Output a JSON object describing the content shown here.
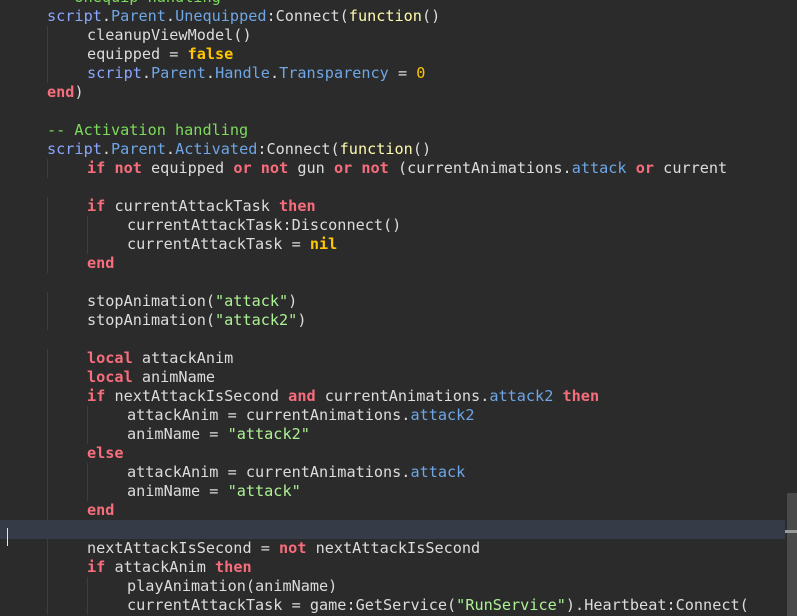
{
  "editor": {
    "lines": [
      {
        "indent": 0,
        "tokens": [
          {
            "t": "-- Unequip handling",
            "c": "comment"
          }
        ]
      },
      {
        "indent": 0,
        "tokens": [
          {
            "t": "script",
            "c": "builtin"
          },
          {
            "t": ".",
            "c": "plain"
          },
          {
            "t": "Parent",
            "c": "prop"
          },
          {
            "t": ".",
            "c": "plain"
          },
          {
            "t": "Unequipped",
            "c": "prop"
          },
          {
            "t": ":Connect(",
            "c": "plain"
          },
          {
            "t": "function",
            "c": "func"
          },
          {
            "t": "()",
            "c": "plain"
          }
        ]
      },
      {
        "indent": 1,
        "tokens": [
          {
            "t": "cleanupViewModel()",
            "c": "plain"
          }
        ]
      },
      {
        "indent": 1,
        "tokens": [
          {
            "t": "equipped = ",
            "c": "plain"
          },
          {
            "t": "false",
            "c": "bool"
          }
        ]
      },
      {
        "indent": 1,
        "tokens": [
          {
            "t": "script",
            "c": "builtin"
          },
          {
            "t": ".",
            "c": "plain"
          },
          {
            "t": "Parent",
            "c": "prop"
          },
          {
            "t": ".",
            "c": "plain"
          },
          {
            "t": "Handle",
            "c": "prop"
          },
          {
            "t": ".",
            "c": "plain"
          },
          {
            "t": "Transparency",
            "c": "prop"
          },
          {
            "t": " = ",
            "c": "plain"
          },
          {
            "t": "0",
            "c": "num"
          }
        ]
      },
      {
        "indent": 0,
        "tokens": [
          {
            "t": "end",
            "c": "kw"
          },
          {
            "t": ")",
            "c": "plain"
          }
        ]
      },
      {
        "indent": 0,
        "tokens": []
      },
      {
        "indent": 0,
        "tokens": [
          {
            "t": "-- Activation handling",
            "c": "comment"
          }
        ]
      },
      {
        "indent": 0,
        "tokens": [
          {
            "t": "script",
            "c": "builtin"
          },
          {
            "t": ".",
            "c": "plain"
          },
          {
            "t": "Parent",
            "c": "prop"
          },
          {
            "t": ".",
            "c": "plain"
          },
          {
            "t": "Activated",
            "c": "prop"
          },
          {
            "t": ":Connect(",
            "c": "plain"
          },
          {
            "t": "function",
            "c": "func"
          },
          {
            "t": "()",
            "c": "plain"
          }
        ]
      },
      {
        "indent": 1,
        "tokens": [
          {
            "t": "if",
            "c": "kw"
          },
          {
            "t": " ",
            "c": "plain"
          },
          {
            "t": "not",
            "c": "kw"
          },
          {
            "t": " equipped ",
            "c": "plain"
          },
          {
            "t": "or",
            "c": "kw"
          },
          {
            "t": " ",
            "c": "plain"
          },
          {
            "t": "not",
            "c": "kw"
          },
          {
            "t": " gun ",
            "c": "plain"
          },
          {
            "t": "or",
            "c": "kw"
          },
          {
            "t": " ",
            "c": "plain"
          },
          {
            "t": "not",
            "c": "kw"
          },
          {
            "t": " (currentAnimations.",
            "c": "plain"
          },
          {
            "t": "attack",
            "c": "prop"
          },
          {
            "t": " ",
            "c": "plain"
          },
          {
            "t": "or",
            "c": "kw"
          },
          {
            "t": " current",
            "c": "plain"
          }
        ]
      },
      {
        "indent": 0,
        "tokens": []
      },
      {
        "indent": 1,
        "tokens": [
          {
            "t": "if",
            "c": "kw"
          },
          {
            "t": " currentAttackTask ",
            "c": "plain"
          },
          {
            "t": "then",
            "c": "kw"
          }
        ]
      },
      {
        "indent": 2,
        "tokens": [
          {
            "t": "currentAttackTask:Disconnect()",
            "c": "plain"
          }
        ]
      },
      {
        "indent": 2,
        "tokens": [
          {
            "t": "currentAttackTask = ",
            "c": "plain"
          },
          {
            "t": "nil",
            "c": "bool"
          }
        ]
      },
      {
        "indent": 1,
        "tokens": [
          {
            "t": "end",
            "c": "kw"
          }
        ]
      },
      {
        "indent": 0,
        "tokens": []
      },
      {
        "indent": 1,
        "tokens": [
          {
            "t": "stopAnimation(",
            "c": "plain"
          },
          {
            "t": "\"attack\"",
            "c": "string"
          },
          {
            "t": ")",
            "c": "plain"
          }
        ]
      },
      {
        "indent": 1,
        "tokens": [
          {
            "t": "stopAnimation(",
            "c": "plain"
          },
          {
            "t": "\"attack2\"",
            "c": "string"
          },
          {
            "t": ")",
            "c": "plain"
          }
        ]
      },
      {
        "indent": 0,
        "tokens": []
      },
      {
        "indent": 1,
        "tokens": [
          {
            "t": "local",
            "c": "kw"
          },
          {
            "t": " attackAnim",
            "c": "plain"
          }
        ]
      },
      {
        "indent": 1,
        "tokens": [
          {
            "t": "local",
            "c": "kw"
          },
          {
            "t": " animName",
            "c": "plain"
          }
        ]
      },
      {
        "indent": 1,
        "tokens": [
          {
            "t": "if",
            "c": "kw"
          },
          {
            "t": " nextAttackIsSecond ",
            "c": "plain"
          },
          {
            "t": "and",
            "c": "kw"
          },
          {
            "t": " currentAnimations.",
            "c": "plain"
          },
          {
            "t": "attack2",
            "c": "prop"
          },
          {
            "t": " ",
            "c": "plain"
          },
          {
            "t": "then",
            "c": "kw"
          }
        ]
      },
      {
        "indent": 2,
        "tokens": [
          {
            "t": "attackAnim = currentAnimations.",
            "c": "plain"
          },
          {
            "t": "attack2",
            "c": "prop"
          }
        ]
      },
      {
        "indent": 2,
        "tokens": [
          {
            "t": "animName = ",
            "c": "plain"
          },
          {
            "t": "\"attack2\"",
            "c": "string"
          }
        ]
      },
      {
        "indent": 1,
        "tokens": [
          {
            "t": "else",
            "c": "kw"
          }
        ]
      },
      {
        "indent": 2,
        "tokens": [
          {
            "t": "attackAnim = currentAnimations.",
            "c": "plain"
          },
          {
            "t": "attack",
            "c": "prop"
          }
        ]
      },
      {
        "indent": 2,
        "tokens": [
          {
            "t": "animName = ",
            "c": "plain"
          },
          {
            "t": "\"attack\"",
            "c": "string"
          }
        ]
      },
      {
        "indent": 1,
        "tokens": [
          {
            "t": "end",
            "c": "kw"
          }
        ]
      },
      {
        "indent": 0,
        "tokens": [],
        "current": true
      },
      {
        "indent": 1,
        "tokens": [
          {
            "t": "nextAttackIsSecond = ",
            "c": "plain"
          },
          {
            "t": "not",
            "c": "kw"
          },
          {
            "t": " nextAttackIsSecond",
            "c": "plain"
          }
        ]
      },
      {
        "indent": 1,
        "tokens": [
          {
            "t": "if",
            "c": "kw"
          },
          {
            "t": " attackAnim ",
            "c": "plain"
          },
          {
            "t": "then",
            "c": "kw"
          }
        ]
      },
      {
        "indent": 2,
        "tokens": [
          {
            "t": "playAnimation(animName)",
            "c": "plain"
          }
        ]
      },
      {
        "indent": 2,
        "tokens": [
          {
            "t": "currentAttackTask = game:GetService(",
            "c": "plain"
          },
          {
            "t": "\"RunService\"",
            "c": "string"
          },
          {
            "t": ").Heartbeat:Connect(",
            "c": "plain"
          }
        ]
      }
    ],
    "scrollbar": {
      "thumb_start": 0.8,
      "thumb_end": 1.0,
      "marker_position": 0.86
    }
  },
  "colors": {
    "background": "#2b2b2b",
    "current_line": "#353b47",
    "comment": "#7ddc5b",
    "keyword": "#f86d7c",
    "builtin": "#8aa6ff",
    "property": "#6ea6e6",
    "function_keyword": "#fdfbac",
    "boolean": "#ffc600",
    "string": "#adf195",
    "text": "#dcdcdc"
  }
}
